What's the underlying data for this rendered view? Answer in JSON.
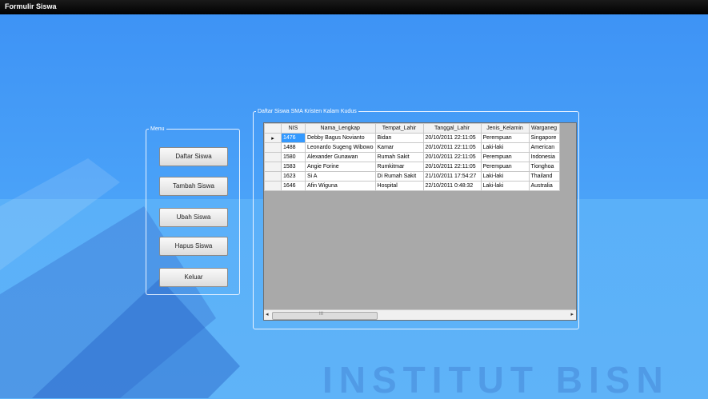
{
  "window": {
    "title": "Formulir Siswa"
  },
  "menu": {
    "legend": "Menu",
    "buttons": [
      "Daftar Siswa",
      "Tambah Siswa",
      "Ubah Siswa",
      "Hapus Siswa",
      "Keluar"
    ]
  },
  "grid": {
    "legend": "Daftar Siswa SMA Kristen Kalam Kudus",
    "columns": [
      "NIS",
      "Nama_Lengkap",
      "Tempat_Lahir",
      "Tanggal_Lahir",
      "Jenis_Kelamin",
      "Warganeg"
    ],
    "rows": [
      [
        "1476",
        "Debby Bagus Novianto",
        "Bidan",
        "20/10/2011 22:11:05",
        "Perempuan",
        "Singapore"
      ],
      [
        "1488",
        "Leonardo Sugeng Wibowo",
        "Kamar",
        "20/10/2011 22:11:05",
        "Laki-laki",
        "American"
      ],
      [
        "1580",
        "Alexander Gunawan",
        "Rumah Sakit",
        "20/10/2011 22:11:05",
        "Perempuan",
        "Indonesia"
      ],
      [
        "1583",
        "Angie Forine",
        "Rumkitmar",
        "20/10/2011 22:11:05",
        "Perempuan",
        "Tionghoa"
      ],
      [
        "1623",
        "Si A",
        "Di Rumah Sakit",
        "21/10/2011 17:54:27",
        "Laki-laki",
        "Thailand"
      ],
      [
        "1646",
        "Afin Wiguna",
        "Hospital",
        "22/10/2011 0:48:32",
        "Laki-laki",
        "Australia"
      ]
    ],
    "current_row_marker": "▸",
    "scroll_left": "◂",
    "scroll_right": "▸",
    "scroll_thumb": "III"
  },
  "watermark": {
    "text": "INSTITUT BISN"
  },
  "colors": {
    "background": "#4a9df0",
    "selection": "#3399ff",
    "grid_empty": "#a9a9a9"
  }
}
